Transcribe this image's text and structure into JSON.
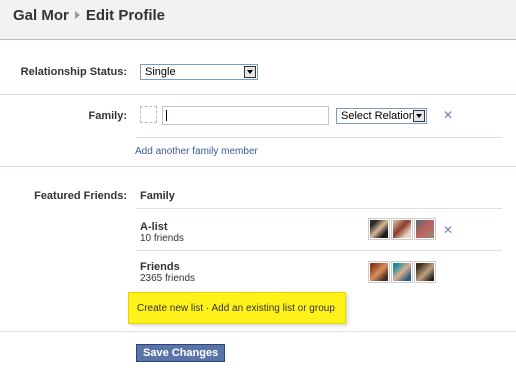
{
  "header": {
    "name": "Gal Mor",
    "title": "Edit Profile"
  },
  "relationship": {
    "label": "Relationship Status:",
    "value": "Single"
  },
  "family": {
    "label": "Family:",
    "input_value": "",
    "relation_select": "Select Relation:",
    "add_link": "Add another family member"
  },
  "featured": {
    "label": "Featured Friends:",
    "first_item": "Family",
    "lists": [
      {
        "name": "A-list",
        "count": "10 friends"
      },
      {
        "name": "Friends",
        "count": "2365 friends"
      }
    ]
  },
  "tooltip": {
    "text": "Create new list · Add an existing list or group"
  },
  "save_button": "Save Changes",
  "colors": {
    "link": "#3b5998",
    "button_bg": "#5b74a8",
    "tooltip_bg": "#fff21a",
    "header_bg": "#f2f2f2"
  }
}
